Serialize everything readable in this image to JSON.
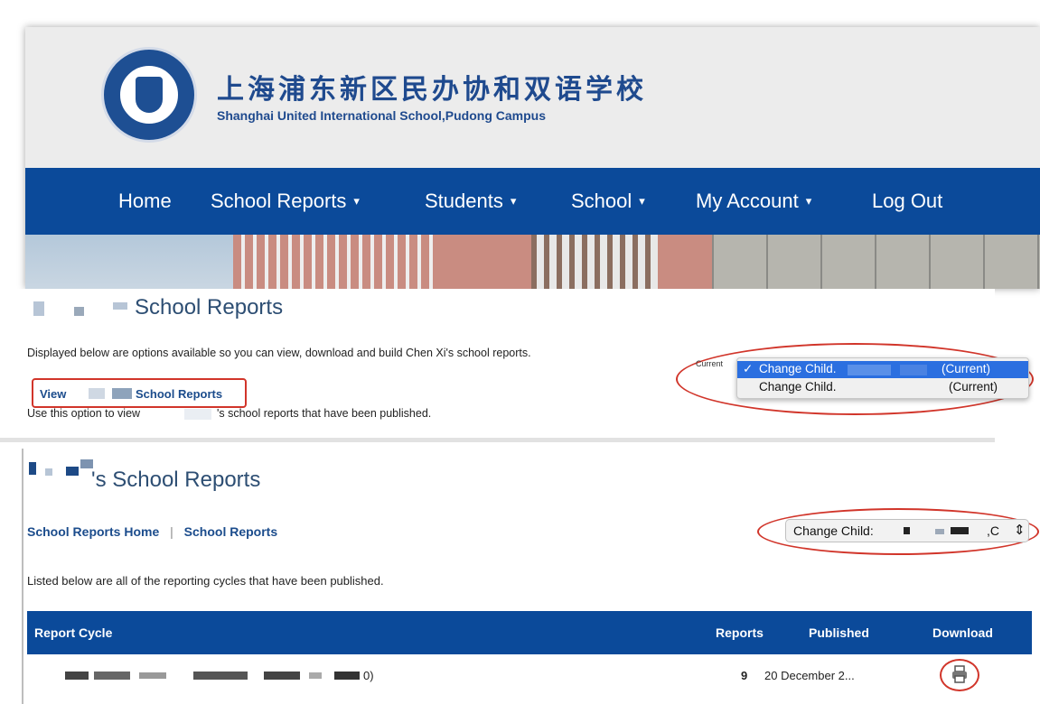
{
  "site": {
    "name_cn": "上海浦东新区民办协和双语学校",
    "name_en": "Shanghai United International School,Pudong Campus"
  },
  "nav": {
    "items": [
      {
        "label": "Home",
        "dropdown": false
      },
      {
        "label": "School Reports",
        "dropdown": true
      },
      {
        "label": "Students",
        "dropdown": true
      },
      {
        "label": "School",
        "dropdown": true
      },
      {
        "label": "My Account",
        "dropdown": true
      },
      {
        "label": "Log Out",
        "dropdown": false
      }
    ],
    "chevron": "⌄"
  },
  "options_page": {
    "title": "School Reports",
    "description": "Displayed below are options available so you can view, download and build Chen Xi's school reports.",
    "view_link": {
      "prefix": "View",
      "suffix": "School Reports"
    },
    "view_desc_prefix": "Use this option to view",
    "view_desc_suffix": "'s school reports that have been published.",
    "current_label": "Current",
    "dropdown_options": [
      {
        "label": "Change Child.",
        "suffix": "(Current)",
        "selected": true,
        "check": "✓"
      },
      {
        "label": "Change Child.",
        "suffix": "(Current)",
        "selected": false,
        "check": ""
      }
    ]
  },
  "reports_page": {
    "title": "'s School Reports",
    "breadcrumb": {
      "home": "School Reports Home",
      "separator": "|",
      "current": "School Reports"
    },
    "change_child": {
      "label": "Change Child:",
      "value_suffix": ",C",
      "arrows": "⇕"
    },
    "description": "Listed below are all of the reporting cycles that have been published.",
    "table": {
      "headers": {
        "cycle": "Report Cycle",
        "reports": "Reports",
        "published": "Published",
        "download": "Download"
      },
      "rows": [
        {
          "cycle_visible": "0)",
          "reports": "9",
          "published": "20 December 2...",
          "download_icon": "print-icon"
        }
      ]
    }
  },
  "colors": {
    "brand_blue": "#0b4a9a",
    "title_blue": "#1f4a8e",
    "annotation_red": "#d1352a"
  }
}
